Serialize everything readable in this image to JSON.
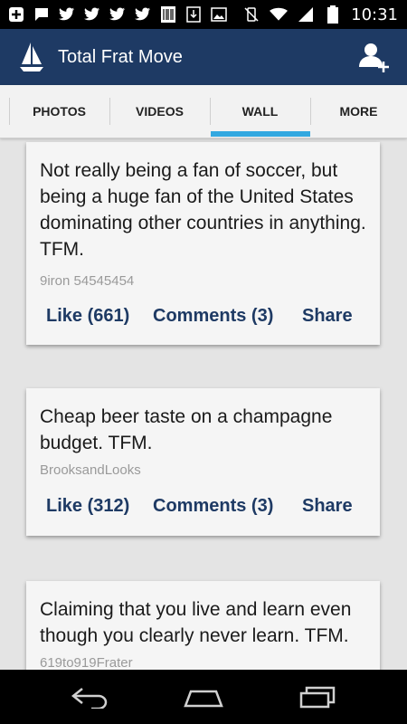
{
  "status_bar": {
    "time": "10:31",
    "left_icons": [
      "add-icon",
      "chat-icon",
      "twitter-icon",
      "twitter-icon",
      "twitter-icon",
      "twitter-icon",
      "barcode-icon",
      "download-icon",
      "image-icon"
    ],
    "right_icons": [
      "vibrate-off-icon",
      "wifi-icon",
      "signal-icon",
      "battery-icon"
    ]
  },
  "app_bar": {
    "title": "Total Frat Move",
    "logo_icon": "sailboat-icon",
    "action_icon": "add-user-icon",
    "color": "#1e3a64"
  },
  "tabs": [
    {
      "label": "PHOTOS",
      "selected": false
    },
    {
      "label": "VIDEOS",
      "selected": false
    },
    {
      "label": "WALL",
      "selected": true
    },
    {
      "label": "MORE",
      "selected": false
    }
  ],
  "posts": [
    {
      "text": "Not really being a fan of soccer, but being a huge fan of the United States dominating other countries in anything. TFM.",
      "user": "9iron 54545454",
      "like": "Like (661)",
      "comments": "Comments (3)",
      "share": "Share"
    },
    {
      "text": "Cheap beer taste on a champagne budget. TFM.",
      "user": "BrooksandLooks",
      "like": "Like (312)",
      "comments": "Comments (3)",
      "share": "Share"
    },
    {
      "text": "Claiming that you live and learn even though you clearly never learn. TFM.",
      "user": "619to919Frater"
    }
  ],
  "nav_bar": [
    "back-icon",
    "home-icon",
    "recents-icon"
  ],
  "colors": {
    "accent": "#33a8e0",
    "action_text": "#1e3a64"
  }
}
